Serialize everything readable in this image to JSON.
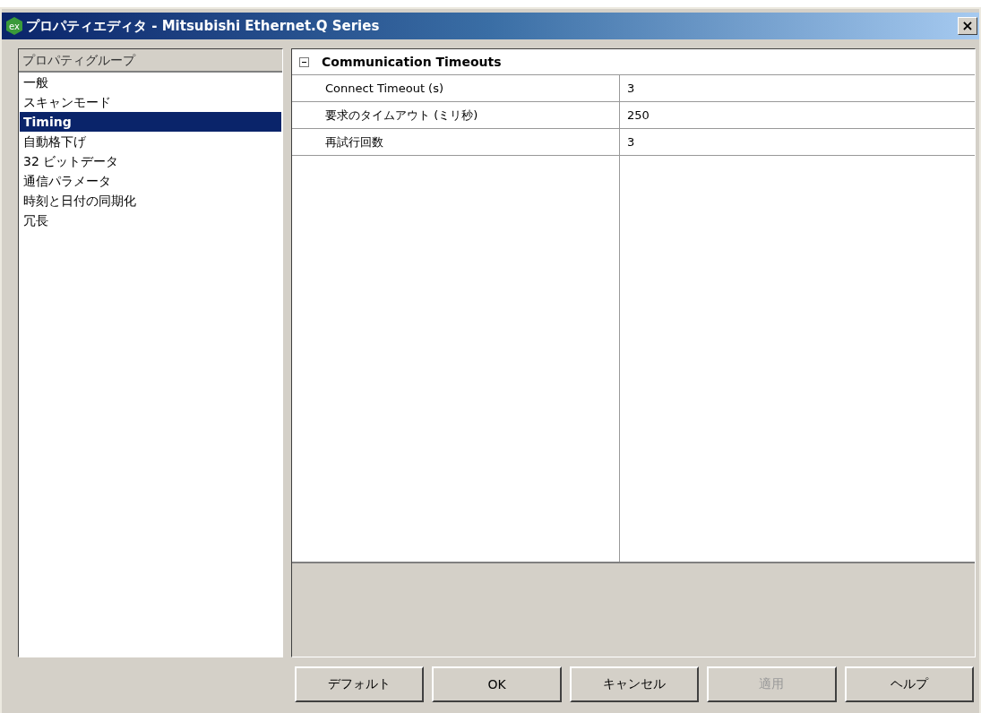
{
  "window": {
    "logo": "ex",
    "title": "プロパティエディタ - Mitsubishi Ethernet.Q Series",
    "close": "×"
  },
  "sidebar": {
    "header": "プロパティグループ",
    "items": [
      {
        "label": "一般",
        "selected": false
      },
      {
        "label": "スキャンモード",
        "selected": false
      },
      {
        "label": "Timing",
        "selected": true
      },
      {
        "label": "自動格下げ",
        "selected": false
      },
      {
        "label": "32 ビットデータ",
        "selected": false
      },
      {
        "label": "通信パラメータ",
        "selected": false
      },
      {
        "label": "時刻と日付の同期化",
        "selected": false
      },
      {
        "label": "冗長",
        "selected": false
      }
    ]
  },
  "grid": {
    "section": {
      "title": "Communication Timeouts",
      "expanded": true
    },
    "rows": [
      {
        "name": "Connect Timeout (s)",
        "value": "3"
      },
      {
        "name": "要求のタイムアウト (ミリ秒)",
        "value": "250"
      },
      {
        "name": "再試行回数",
        "value": "3"
      }
    ]
  },
  "buttons": [
    {
      "label": "デフォルト",
      "disabled": false
    },
    {
      "label": "OK",
      "disabled": false
    },
    {
      "label": "キャンセル",
      "disabled": false
    },
    {
      "label": "適用",
      "disabled": true
    },
    {
      "label": "ヘルプ",
      "disabled": false
    }
  ]
}
